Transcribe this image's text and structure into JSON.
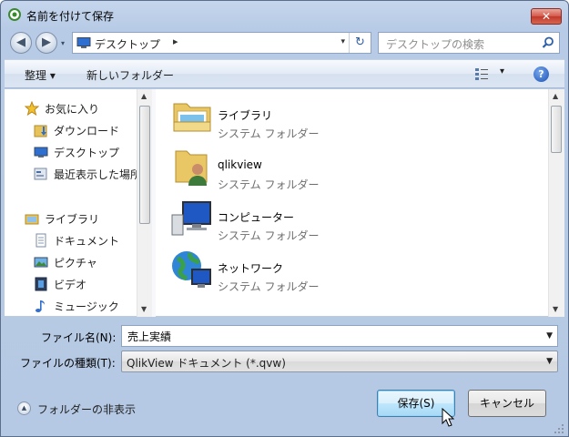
{
  "window": {
    "title": "名前を付けて保存",
    "close_symbol": "✕"
  },
  "address_bar": {
    "back_symbol": "◀",
    "forward_symbol": "▶",
    "location": "デスクトップ",
    "separator": "▸",
    "dropdown_symbol": "▾",
    "refresh_symbol": "↻",
    "location_icon": "computer-icon"
  },
  "search": {
    "placeholder": "デスクトップの検索"
  },
  "toolbar": {
    "organize_label": "整理 ▾",
    "new_folder_label": "新しいフォルダー",
    "view_dropdown": "▾",
    "help_label": "?"
  },
  "nav": {
    "favorites": {
      "label": "お気に入り",
      "items": [
        "ダウンロード",
        "デスクトップ",
        "最近表示した場所"
      ]
    },
    "libraries": {
      "label": "ライブラリ",
      "items": [
        "ドキュメント",
        "ピクチャ",
        "ビデオ",
        "ミュージック"
      ]
    }
  },
  "files": [
    {
      "name": "ライブラリ",
      "type": "システム フォルダー",
      "icon": "library-icon"
    },
    {
      "name": "qlikview",
      "type": "システム フォルダー",
      "icon": "user-folder-icon"
    },
    {
      "name": "コンピューター",
      "type": "システム フォルダー",
      "icon": "computer-icon"
    },
    {
      "name": "ネットワーク",
      "type": "システム フォルダー",
      "icon": "network-icon"
    }
  ],
  "form": {
    "filename_label": "ファイル名(N):",
    "filename_value": "売上実績",
    "filetype_label": "ファイルの種類(T):",
    "filetype_value": "QlikView ドキュメント (*.qvw)"
  },
  "footer": {
    "hide_folders_label": "フォルダーの非表示",
    "save_label": "保存(S)",
    "cancel_label": "キャンセル"
  },
  "colors": {
    "frame": "#b8cbe6",
    "accent": "#3c7fb1",
    "secondary_text": "#6d6d6d"
  }
}
